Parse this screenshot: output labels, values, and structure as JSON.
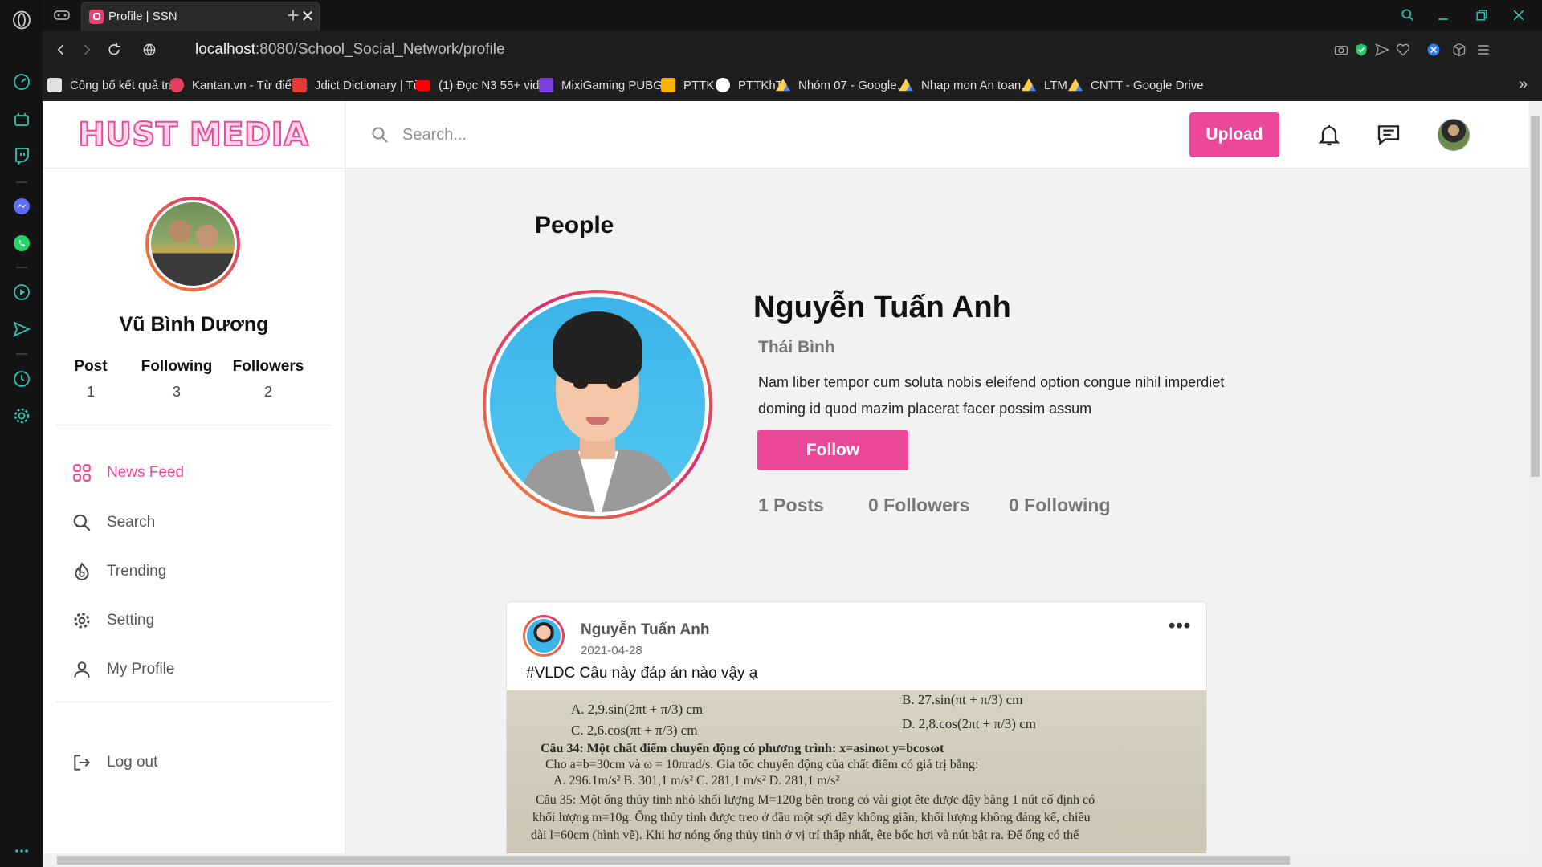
{
  "browser": {
    "tab_title": "Profile | SSN",
    "tab_close": "✕",
    "new_tab": "+",
    "url_host": "localhost",
    "url_path": ":8080/School_Social_Network/profile",
    "bookmarks": [
      {
        "label": "Công bố kết quả tr...",
        "color": "#e0e0e0"
      },
      {
        "label": "Kantan.vn - Từ điển...",
        "color": "#e4405f"
      },
      {
        "label": "Jdict Dictionary | Từ...",
        "color": "#e53935"
      },
      {
        "label": "(1) Đọc N3 55+ vid...",
        "color": "#ff0000"
      },
      {
        "label": "MixiGaming PUBG...",
        "color": "#7b3fe4"
      },
      {
        "label": "PTTK",
        "color": "#f6b400"
      },
      {
        "label": "PTTKhT",
        "color": "#ffffff"
      },
      {
        "label": "Nhóm 07 - Google...",
        "color": "#1fa463"
      },
      {
        "label": "Nhap mon An toan...",
        "color": "#1fa463"
      },
      {
        "label": "LTM",
        "color": "#1fa463"
      },
      {
        "label": "CNTT - Google Drive",
        "color": "#1fa463"
      }
    ],
    "bookmarks_more": "»"
  },
  "app": {
    "logo": "HUST MEDIA",
    "search_placeholder": "Search...",
    "upload_label": "Upload"
  },
  "sidebar": {
    "user_name": "Vũ Bình Dương",
    "stats": [
      {
        "label": "Post",
        "value": "1"
      },
      {
        "label": "Following",
        "value": "3"
      },
      {
        "label": "Followers",
        "value": "2"
      }
    ],
    "menu": [
      {
        "label": "News Feed",
        "icon": "grid-icon",
        "active": true
      },
      {
        "label": "Search",
        "icon": "search-icon",
        "active": false
      },
      {
        "label": "Trending",
        "icon": "fire-icon",
        "active": false
      },
      {
        "label": "Setting",
        "icon": "gear-icon",
        "active": false
      },
      {
        "label": "My Profile",
        "icon": "user-icon",
        "active": false
      }
    ],
    "logout": "Log out"
  },
  "profile": {
    "section_title": "People",
    "name": "Nguyễn Tuấn Anh",
    "location": "Thái Bình",
    "bio": "Nam liber tempor cum soluta nobis eleifend option congue nihil imperdiet doming id quod mazim placerat facer possim assum",
    "follow_label": "Follow",
    "posts": "1 Posts",
    "followers": "0 Followers",
    "following": "0 Following"
  },
  "post": {
    "author": "Nguyễn Tuấn Anh",
    "date": "2021-04-28",
    "more": "•••",
    "text": "#VLDC Câu này đáp án nào vậy ạ",
    "image_lines": [
      "A. 2,9.sin(2πt + π/3) cm",
      "B. 27.sin(πt + π/3) cm",
      "C. 2,6.cos(πt + π/3) cm",
      "D. 2,8.cos(2πt + π/3) cm",
      "Câu 34: Một chất điểm chuyển động có phương trình: x=asinωt y=bcosωt",
      "Cho a=b=30cm và ω = 10πrad/s. Gia tốc chuyển động của chất điểm có giá trị bằng:",
      "A. 296.1m/s²        B. 301,1 m/s²        C. 281,1 m/s²        D. 281,1 m/s²",
      "Câu 35: Một ống thủy tinh nhỏ khối lượng M=120g bên trong có vài giọt ête được đậy bằng 1 nút cố định có",
      "khối lượng m=10g. Ống thủy tinh được treo ở đầu một sợi dây không giãn, khối lượng không đáng kể, chiều",
      "dài l=60cm (hình vẽ). Khi hơ nóng ống thủy tinh ở vị trí thấp nhất, ête bốc hơi và nút bật ra. Để ống có thể"
    ]
  },
  "colors": {
    "accent": "#ec4899",
    "brand_pink": "#ec4899"
  }
}
